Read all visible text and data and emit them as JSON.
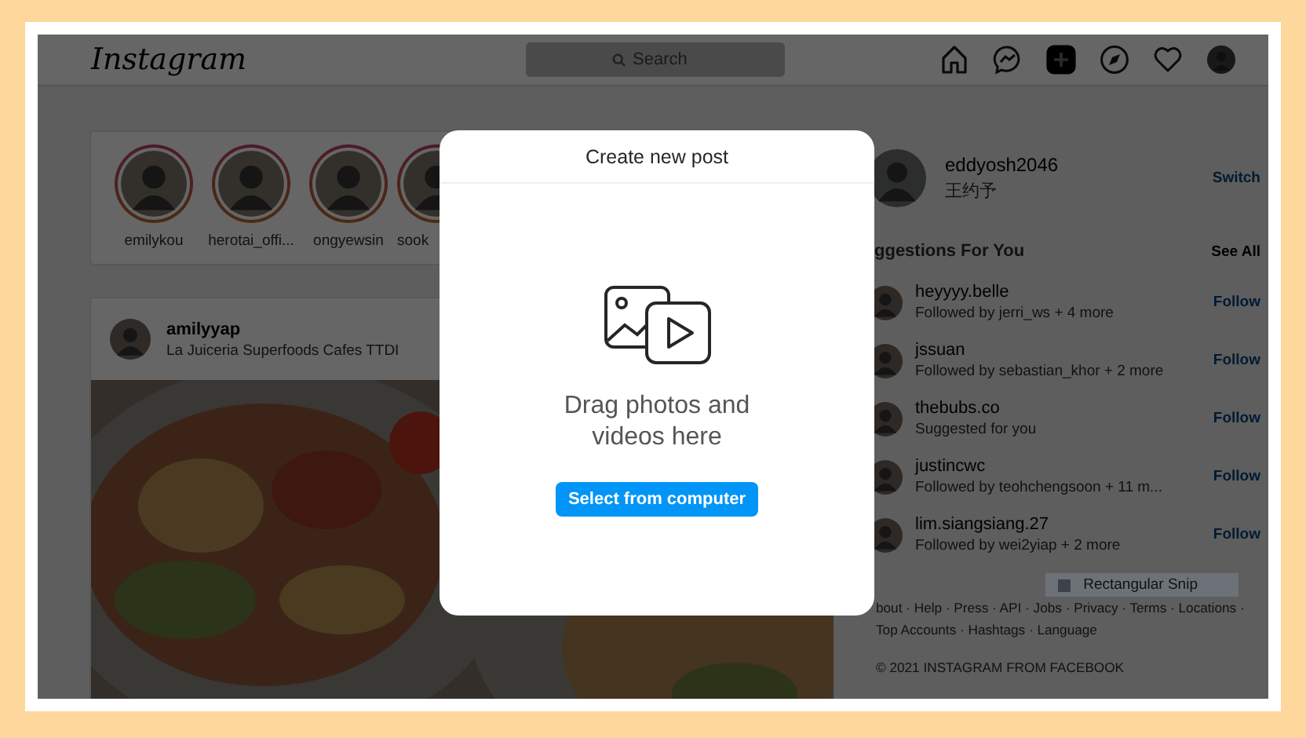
{
  "topbar": {
    "logo": "Instagram",
    "search": {
      "placeholder": "Search"
    },
    "nav": [
      {
        "kind": "home",
        "selected": false
      },
      {
        "kind": "messenger",
        "selected": false
      },
      {
        "kind": "new_post",
        "selected": true
      },
      {
        "kind": "explore",
        "selected": false
      },
      {
        "kind": "activity",
        "selected": false
      },
      {
        "kind": "profile",
        "selected": false
      }
    ]
  },
  "stories": [
    {
      "name": "emilykou"
    },
    {
      "name": "herotai_offi..."
    },
    {
      "name": "ongyewsin"
    },
    {
      "name": "sook"
    }
  ],
  "post": {
    "username": "amilyyap",
    "location": "La Juiceria Superfoods Cafes TTDI"
  },
  "profile": {
    "username": "eddyosh2046",
    "name": "王约予",
    "action": "Switch"
  },
  "suggestions": {
    "title": "ggestions For You",
    "see_all": "See All",
    "items": [
      {
        "username": "heyyyy.belle",
        "note": "Followed by jerri_ws + 4 more",
        "action": "Follow"
      },
      {
        "username": "jssuan",
        "note": "Followed by sebastian_khor + 2 more",
        "action": "Follow"
      },
      {
        "username": "thebubs.co",
        "note": "Suggested for you",
        "action": "Follow"
      },
      {
        "username": "justincwc",
        "note": "Followed by teohchengsoon + 11 m...",
        "action": "Follow"
      },
      {
        "username": "lim.siangsiang.27",
        "note": "Followed by wei2yiap + 2 more",
        "action": "Follow"
      }
    ]
  },
  "snip_tooltip": {
    "label": "Rectangular Snip"
  },
  "footer": {
    "links": "bout · Help · Press · API · Jobs · Privacy · Terms · Locations ·",
    "links_more": "Top Accounts · Hashtags · Language",
    "copyright": "© 2021 INSTAGRAM FROM FACEBOOK"
  },
  "modal": {
    "title": "Create new post",
    "message": "Drag photos and videos here",
    "button": "Select from computer"
  }
}
